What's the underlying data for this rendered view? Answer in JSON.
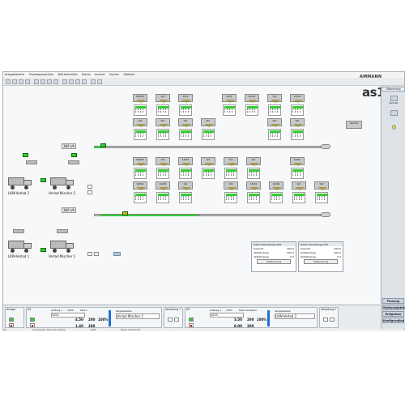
{
  "menu": [
    "Anlagebereich",
    "Prozessparameter",
    "Betriebsmittel",
    "Extras",
    "Ansicht",
    "Suchen",
    "Statistik"
  ],
  "brand": {
    "ammann": "AMMANN",
    "as1": "as1"
  },
  "sidebar": {
    "title": "Steuerung",
    "item1": "Betrieb",
    "item2": "",
    "buttons": [
      "Planung",
      "Stationsdaten",
      "Ereignisse",
      "Konfiguration"
    ]
  },
  "upper_bins_row1": [
    "8/45/3",
    "0/4",
    "12/2",
    "16/5",
    "22/32",
    "0/1",
    "22/32",
    "8/1"
  ],
  "upper_bins_row2": [
    "0/4",
    "8/1",
    "0/1",
    "8/1",
    "8/1",
    "0/1"
  ],
  "lower_bins_row1": [
    "45/8/5",
    "0/4",
    "16/32",
    "0/4",
    "0/1",
    "0/1",
    "16/32"
  ],
  "lower_bins_row2": [
    "0/450",
    "22/45",
    "0/1",
    "0/4",
    "16/32",
    "22/16",
    "0/1",
    "0/4"
  ],
  "belt_labels": [
    "366 t/h",
    "366 t/h"
  ],
  "trucks": {
    "t1": "LKW-Verlad 2",
    "t2": "Verlad Mischer 2",
    "t3": "LKW-Verlad 1",
    "t4": "Verlad Mischer 1"
  },
  "scales": {
    "left": {
      "title": "Daten Bandwaage 006",
      "r1k": "Gewicht",
      "r1v": "200.0",
      "r2k": "Abfallmenge",
      "r2v": "600.0",
      "r3k": "Abfallmenge",
      "r3v": "0.0",
      "btn": "Kalibrierung"
    },
    "right": {
      "title": "Daten Bandwaage 007",
      "r1k": "Gewicht",
      "r1v": "200.0",
      "r2k": "Abfallmenge",
      "r2v": "600.0",
      "r3k": "Abfallmenge",
      "r3v": "0.0",
      "btn": "Kalibrierung"
    }
  },
  "bottom": {
    "g1": "Anlage",
    "g2": "D1",
    "g2_order": "Auftrag 1",
    "g2_order_no": "1002",
    "g2_text": "Text 1",
    "g2_val": "1002",
    "g2_menge": "4.50",
    "g2_leistung": "200",
    "g2_pct": "100%",
    "g2_menge2": "1.40",
    "g2_leistung2": "200",
    "g2_dest_label": "Abgabestelle",
    "g2_dest": "Verlad Mischer 1",
    "g3": "Verladung 1",
    "g4": "D2",
    "g4_order": "Auftrag 2",
    "g4_order_no": "1003",
    "g4_text": "Keine Auswahl",
    "g4_val": "1003",
    "g4_menge": "3.50",
    "g4_leistung": "200",
    "g4_pct": "100%",
    "g4_menge2": "0.00",
    "g4_leistung2": "200",
    "g4_dest_label": "Abgabestelle",
    "g4_dest": "LKW-Verlad 2",
    "g5": "Verladung 2"
  },
  "status": [
    "Anl.",
    "ComoSystem  Sekunden-Fenster",
    "NUM",
    "Bereit, Sichtmodus"
  ],
  "colors": {
    "green": "#33cc33",
    "belt": "#d0d0d0",
    "accent_blue": "#1f6fd6"
  }
}
